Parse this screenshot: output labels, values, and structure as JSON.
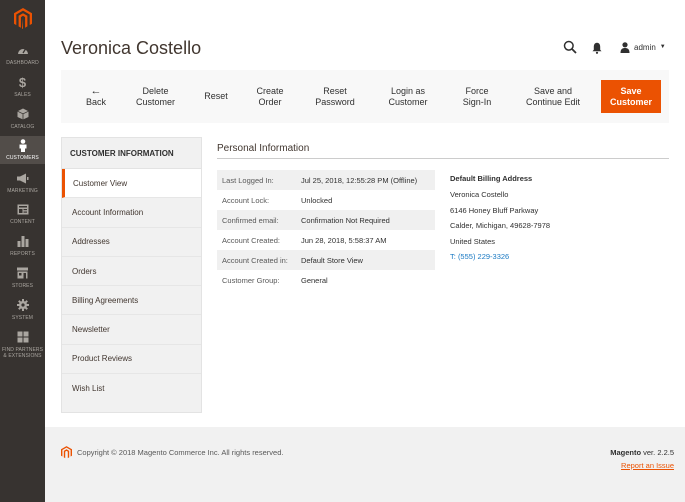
{
  "menu": {
    "items": [
      {
        "label": "DASHBOARD",
        "icon": "dashboard-icon"
      },
      {
        "label": "SALES",
        "icon": "dollar-icon"
      },
      {
        "label": "CATALOG",
        "icon": "box-icon"
      },
      {
        "label": "CUSTOMERS",
        "icon": "person-icon"
      },
      {
        "label": "MARKETING",
        "icon": "megaphone-icon"
      },
      {
        "label": "CONTENT",
        "icon": "layout-icon"
      },
      {
        "label": "REPORTS",
        "icon": "bar-chart-icon"
      },
      {
        "label": "STORES",
        "icon": "store-icon"
      },
      {
        "label": "SYSTEM",
        "icon": "gear-icon"
      },
      {
        "label": "FIND PARTNERS & EXTENSIONS",
        "icon": "partners-icon"
      }
    ],
    "active": "CUSTOMERS",
    "colors": {
      "background": "#373330",
      "active": "#524d49",
      "logo": "#eb5202"
    }
  },
  "header": {
    "title": "Veronica Costello",
    "user": "admin"
  },
  "toolbar": {
    "back": "Back",
    "delete_line1": "Delete",
    "delete_line2": "Customer",
    "reset": "Reset",
    "create_line1": "Create",
    "create_line2": "Order",
    "reset_pw_line1": "Reset",
    "reset_pw_line2": "Password",
    "login_line1": "Login as",
    "login_line2": "Customer",
    "force_line1": "Force",
    "force_line2": "Sign-In",
    "save_continue_line1": "Save and",
    "save_continue_line2": "Continue Edit",
    "save_line1": "Save",
    "save_line2": "Customer",
    "accent": "#eb5202"
  },
  "tabs": {
    "heading": "CUSTOMER INFORMATION",
    "items": [
      "Customer View",
      "Account Information",
      "Addresses",
      "Orders",
      "Billing Agreements",
      "Newsletter",
      "Product Reviews",
      "Wish List"
    ],
    "active": "Customer View"
  },
  "personal_info": {
    "title": "Personal Information",
    "rows": [
      {
        "label": "Last Logged In:",
        "value": "Jul 25, 2018, 12:55:28 PM (Offline)"
      },
      {
        "label": "Account Lock:",
        "value": "Unlocked"
      },
      {
        "label": "Confirmed email:",
        "value": "Confirmation Not Required"
      },
      {
        "label": "Account Created:",
        "value": "Jun 28, 2018, 5:58:37 AM"
      },
      {
        "label": "Account Created in:",
        "value": "Default Store View"
      },
      {
        "label": "Customer Group:",
        "value": "General"
      }
    ]
  },
  "billing": {
    "title": "Default Billing Address",
    "name": "Veronica Costello",
    "street": "6146 Honey Bluff Parkway",
    "city": "Calder, Michigan, 49628-7978",
    "country": "United States",
    "phone_prefix": "T:",
    "phone": "(555) 229-3326"
  },
  "footer": {
    "copyright": "Copyright © 2018 Magento Commerce Inc. All rights reserved.",
    "brand": "Magento",
    "version": "ver. 2.2.5",
    "report": "Report an Issue"
  }
}
